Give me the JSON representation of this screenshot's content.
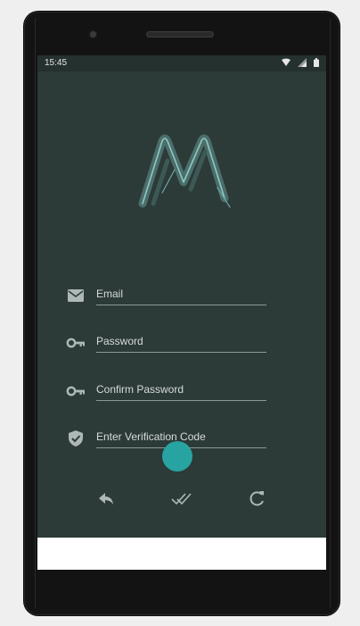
{
  "status_bar": {
    "time": "15:45",
    "icons": [
      "wifi-icon",
      "signal-icon",
      "battery-icon"
    ]
  },
  "logo": {
    "icon": "app-logo-icon"
  },
  "form": {
    "fields": [
      {
        "label": "Email",
        "icon": "mail-icon"
      },
      {
        "label": "Password",
        "icon": "key-icon"
      },
      {
        "label": "Confirm Password",
        "icon": "key-icon"
      },
      {
        "label": "Enter Verification Code",
        "icon": "shield-check-icon"
      }
    ]
  },
  "actions": [
    {
      "name": "back",
      "icon": "reply-icon"
    },
    {
      "name": "confirm",
      "icon": "double-check-icon"
    },
    {
      "name": "refresh",
      "icon": "refresh-icon"
    }
  ],
  "colors": {
    "screen_background": "#2c3a38",
    "accent": "#27a3a1",
    "text": "#d7dcdb",
    "icon": "#aeb8b6"
  }
}
